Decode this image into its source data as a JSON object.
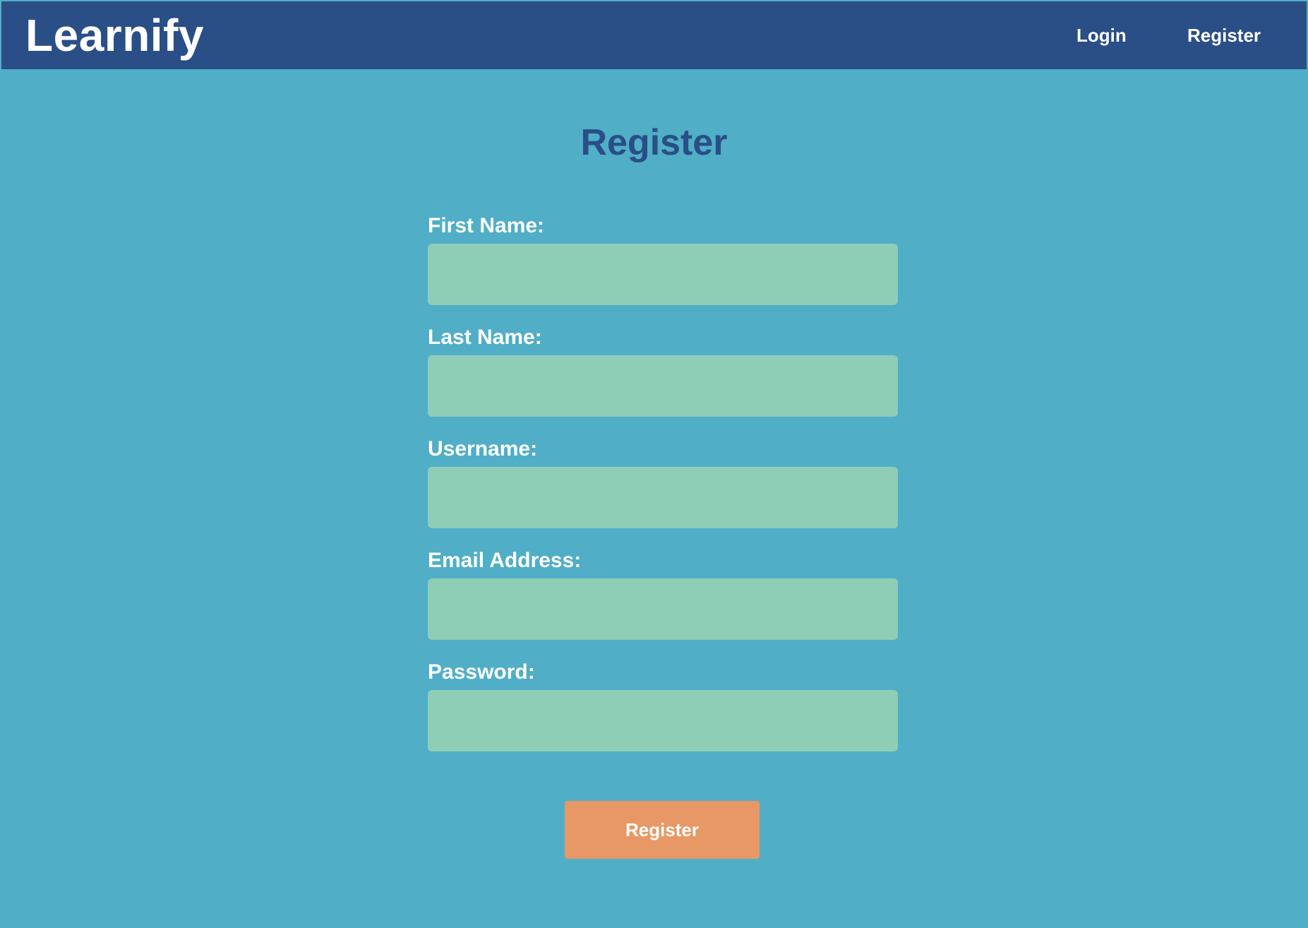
{
  "navbar": {
    "brand": "Learnify",
    "links": [
      {
        "label": "Login"
      },
      {
        "label": "Register"
      }
    ]
  },
  "form": {
    "title": "Register",
    "fields": [
      {
        "label": "First Name:",
        "value": "",
        "placeholder": ""
      },
      {
        "label": "Last Name:",
        "value": "",
        "placeholder": ""
      },
      {
        "label": "Username:",
        "value": "",
        "placeholder": ""
      },
      {
        "label": "Email Address:",
        "value": "",
        "placeholder": ""
      },
      {
        "label": "Password:",
        "value": "",
        "placeholder": ""
      }
    ],
    "submit_label": "Register"
  },
  "colors": {
    "page_background": "#50aec7",
    "navbar_background": "#2a4e86",
    "title_color": "#2a4e86",
    "input_background": "#8fceb6",
    "button_background": "#e89864",
    "text_on_dark": "#ffffff"
  }
}
